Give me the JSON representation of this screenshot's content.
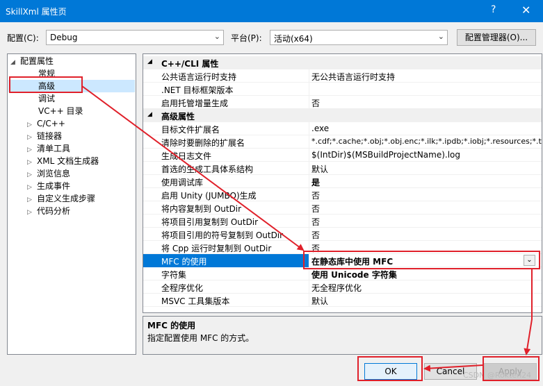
{
  "window": {
    "title": "SkillXml 属性页",
    "help": "?",
    "close": "✕"
  },
  "toolbar": {
    "config_label": "配置(C):",
    "config_value": "Debug",
    "platform_label": "平台(P):",
    "platform_value": "活动(x64)",
    "config_manager": "配置管理器(O)..."
  },
  "tree": {
    "root": "配置属性",
    "items": [
      "常规",
      "高级",
      "调试",
      "VC++ 目录",
      "C/C++",
      "链接器",
      "清单工具",
      "XML 文档生成器",
      "浏览信息",
      "生成事件",
      "自定义生成步骤",
      "代码分析"
    ],
    "selected_index": 1
  },
  "sections": [
    {
      "title": "C++/CLI 属性",
      "rows": [
        {
          "name": "公共语言运行时支持",
          "value": "无公共语言运行时支持"
        },
        {
          "name": ".NET 目标框架版本",
          "value": ""
        },
        {
          "name": "启用托管增量生成",
          "value": "否"
        }
      ]
    },
    {
      "title": "高级属性",
      "rows": [
        {
          "name": "目标文件扩展名",
          "value": ".exe"
        },
        {
          "name": "清除时要删除的扩展名",
          "value": "*.cdf;*.cache;*.obj;*.obj.enc;*.ilk;*.ipdb;*.iobj;*.resources;*.tlb;*"
        },
        {
          "name": "生成日志文件",
          "value": "$(IntDir)$(MSBuildProjectName).log"
        },
        {
          "name": "首选的生成工具体系结构",
          "value": "默认"
        },
        {
          "name": "使用调试库",
          "value": "是"
        },
        {
          "name": "启用 Unity (JUMBO)生成",
          "value": "否"
        },
        {
          "name": "将内容复制到 OutDir",
          "value": "否"
        },
        {
          "name": "将项目引用复制到 OutDir",
          "value": "否"
        },
        {
          "name": "将项目引用的符号复制到 OutDir",
          "value": "否"
        },
        {
          "name": "将 Cpp 运行时复制到 OutDir",
          "value": "否"
        },
        {
          "name": "MFC 的使用",
          "value": "在静态库中使用 MFC"
        },
        {
          "name": "字符集",
          "value": "使用 Unicode 字符集"
        },
        {
          "name": "全程序优化",
          "value": "无全程序优化"
        },
        {
          "name": "MSVC 工具集版本",
          "value": "默认"
        }
      ]
    }
  ],
  "selected_row": "MFC 的使用",
  "description": {
    "title": "MFC 的使用",
    "text": "指定配置使用 MFC 的方式。"
  },
  "buttons": {
    "ok": "OK",
    "cancel": "Cancel",
    "apply": "Apply"
  },
  "watermark": "CSDN @Rokten24",
  "colors": {
    "accent": "#0078d7",
    "annotation": "#e0202a"
  }
}
